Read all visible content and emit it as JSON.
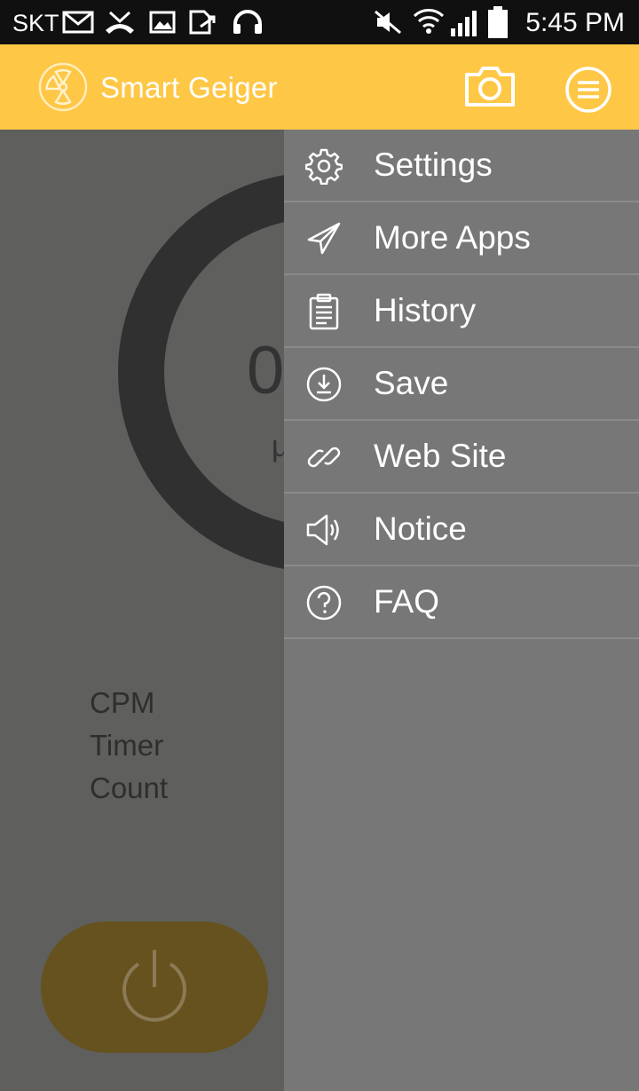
{
  "status_bar": {
    "carrier": "SKT",
    "time": "5:45 PM"
  },
  "app_bar": {
    "title": "Smart Geiger",
    "camera_icon": "camera-icon",
    "menu_icon": "menu-icon"
  },
  "meter": {
    "value": "0",
    "unit": "μ"
  },
  "stats": {
    "cpm_label": "CPM",
    "timer_label": "Timer",
    "count_label": "Count"
  },
  "power_button": {
    "icon": "power-icon",
    "color": "#66521f"
  },
  "drawer": {
    "items": [
      {
        "label": "Settings",
        "icon": "gear-icon"
      },
      {
        "label": "More Apps",
        "icon": "paper-plane-icon"
      },
      {
        "label": "History",
        "icon": "clipboard-icon"
      },
      {
        "label": "Save",
        "icon": "download-icon"
      },
      {
        "label": "Web Site",
        "icon": "link-icon"
      },
      {
        "label": "Notice",
        "icon": "speaker-icon"
      },
      {
        "label": "FAQ",
        "icon": "question-icon"
      }
    ]
  },
  "colors": {
    "accent": "#fec746",
    "drawer_bg": "#777777",
    "dim_bg": "#5f5f5d"
  }
}
